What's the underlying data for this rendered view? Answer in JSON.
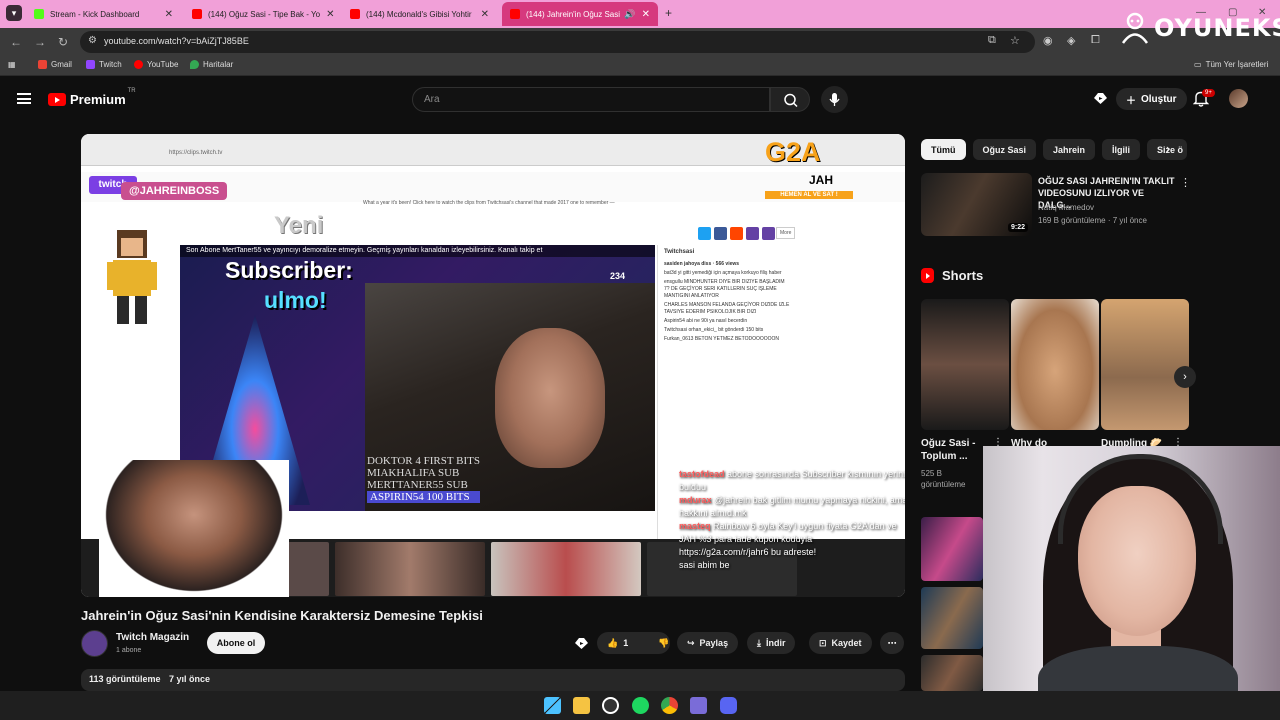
{
  "browser": {
    "tabs": [
      {
        "label": "Stream - Kick Dashboard",
        "color": "#53fc18"
      },
      {
        "label": "(144) Oğuz Sasi - Tipe Bak - Yo",
        "color": "#ff0000"
      },
      {
        "label": "(144) Mcdonald's Gibisi Yohtir",
        "color": "#ff0000"
      },
      {
        "label": "(144) Jahrein'in Oğuz Sasi",
        "color": "#ff0000",
        "active": true
      }
    ],
    "url": "youtube.com/watch?v=bAiZjTJ85BE",
    "bookmarks": [
      "Gmail",
      "Twitch",
      "YouTube",
      "Haritalar"
    ],
    "all_bookmarks": "Tüm Yer İşaretleri"
  },
  "overlay_brand": "OYUNEKS",
  "youtube": {
    "logo": "Premium",
    "logo_sup": "TR",
    "search_placeholder": "Ara",
    "create_label": "Oluştur",
    "notification_count": "9+"
  },
  "video": {
    "twitch_handle": "@JAHREINBOSS",
    "yeni": "Yeni",
    "abone_bar": "Son Abone MertTaner55   ve yayıncıyı demoralize etmeyin. Geçmiş yayınları kanaldan izleyebilirsiniz. Kanalı takip et",
    "sub_title": "Subscriber:",
    "sub_name": "ulmo!",
    "viewers": "234",
    "sub_list": [
      "DOKTOR 4 FIRST BITS",
      "MIAKHALIFA SUB",
      "MERTTANER55 SUB",
      "ASPIRIN54 100 BITS"
    ],
    "g2a_main": "G2A",
    "g2a_jah": "JAH",
    "g2a_sub": "HEMEN AL VE SAT !",
    "chat_head": "Twitchsasi",
    "chat_title": "sasiden jahoya diss · 566 views",
    "chat_lines": [
      "bat3d yi gitti yemediği için açmaya korkuyo filiş haber",
      "ensgullu MINDHUNTER DIYE BIR DIZIYE BAŞLADIM 7? DE GEÇİYOR SERI KATILLERIN SUÇ IŞLEME MANTIGINI ANLATIYOR",
      "CHARLES MANSON FELANDA GEÇİYOR DIZIDE IZLE TAVSIYE EDERIM PSIKOLOJIK BIR DIZI",
      "Aspirin54 abi ne 90i ya nasıl becerdin",
      "Twitchsasi orhan_ekici_ bit gönderdi 150 bits",
      "Furkan_0613 BETON YETMEZ BETODOOOOOON"
    ],
    "overlay_lines": [
      {
        "name": "tastofdead",
        "text": "abone sonrasında Subscriber kısmının yerini bulduu"
      },
      {
        "name": "mdurax",
        "text": "@jahrein bak gitlim mumu yapmaya nickini, ama hakkıni almıd.mk"
      },
      {
        "name": "masteq",
        "text": "Rainbow 6 oyla Key'i uygun fiyata G2A'dan ve JAH %3 para iade kupon koduyla"
      },
      {
        "name": "",
        "text": "https://g2a.com/r/jahr6 bu adreste!"
      },
      {
        "name": "",
        "text": "sasi abim be"
      }
    ],
    "notice": "What a year it's been! Click here to watch the clips from Twitchsasi's channel that made 2017 one to remember —",
    "title": "Jahrein'in Oğuz Sasi'nin Kendisine Karaktersiz Demesine Tepkisi",
    "channel": "Twitch Magazin",
    "subscribers": "1 abone",
    "subscribe_label": "Abone ol",
    "like_count": "1",
    "share_label": "Paylaş",
    "download_label": "İndir",
    "save_label": "Kaydet",
    "views": "113 görüntüleme",
    "age": "7 yıl önce"
  },
  "sidebar": {
    "chips": [
      "Tümü",
      "Oğuz Sasi",
      "Jahrein",
      "İlgili",
      "Size ö"
    ],
    "rec": {
      "title": "OĞUZ SASI JAHREIN'IN TAKLIT VIDEOSUNU IZLIYOR VE DALG...",
      "channel": "Natiq Mamedov",
      "meta": "169 B görüntüleme · 7 yıl önce",
      "duration": "9:22"
    },
    "shorts_label": "Shorts",
    "shorts": [
      {
        "title": "Oğuz Sasi - Toplum ...",
        "views": "525 B görüntüleme"
      },
      {
        "title": "Why do",
        "views": ""
      },
      {
        "title": "Dumpling 🥟",
        "views": ""
      }
    ]
  }
}
